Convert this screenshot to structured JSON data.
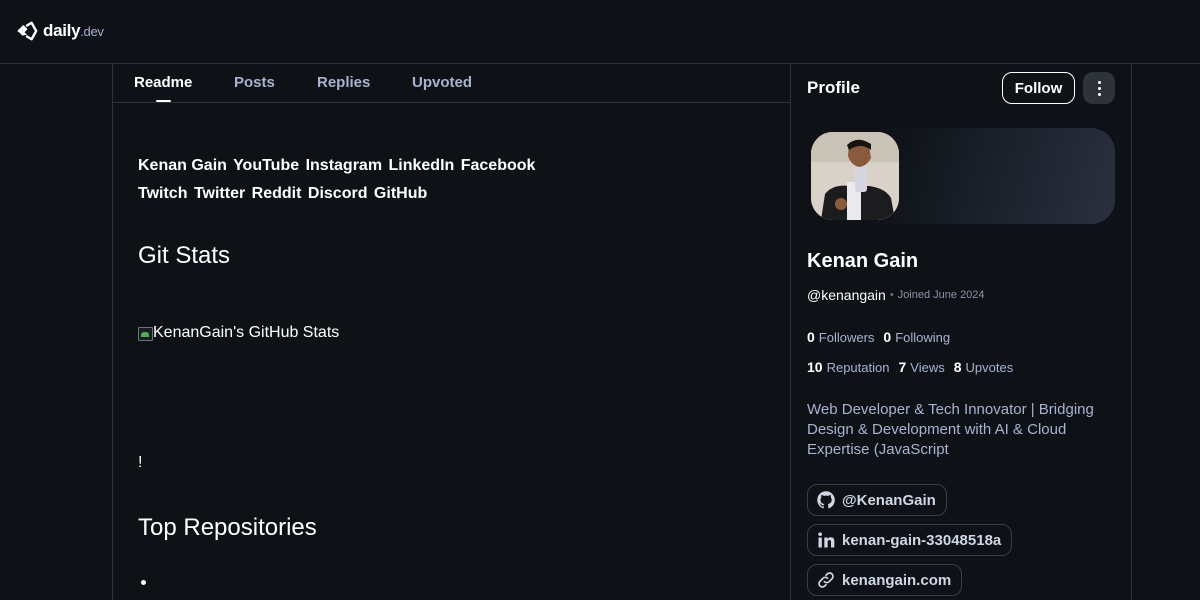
{
  "brand": {
    "name": "daily",
    "suffix": ".dev"
  },
  "tabs": [
    {
      "label": "Readme",
      "active": true
    },
    {
      "label": "Posts",
      "active": false
    },
    {
      "label": "Replies",
      "active": false
    },
    {
      "label": "Upvoted",
      "active": false
    }
  ],
  "readme": {
    "links_row1": [
      "Kenan Gain",
      "YouTube",
      "Instagram",
      "LinkedIn",
      "Facebook"
    ],
    "links_row2": [
      "Twitch",
      "Twitter",
      "Reddit",
      "Discord",
      "GitHub"
    ],
    "git_stats_heading": "Git Stats",
    "stats_image_alt": "KenanGain's GitHub Stats",
    "exclamation": "!",
    "top_repos_heading": "Top Repositories"
  },
  "profile": {
    "section_title": "Profile",
    "follow_label": "Follow",
    "name": "Kenan Gain",
    "handle": "@kenangain",
    "separator": "•",
    "joined": "Joined June 2024",
    "followers": {
      "value": "0",
      "label": "Followers"
    },
    "following": {
      "value": "0",
      "label": "Following"
    },
    "reputation": {
      "value": "10",
      "label": "Reputation"
    },
    "views": {
      "value": "7",
      "label": "Views"
    },
    "upvotes": {
      "value": "8",
      "label": "Upvotes"
    },
    "bio": "Web Developer & Tech Innovator | Bridging Design & Development with AI & Cloud Expertise (JavaScript",
    "links": [
      {
        "icon": "github-icon",
        "label": "@KenanGain"
      },
      {
        "icon": "linkedin-icon",
        "label": "kenan-gain-33048518a"
      },
      {
        "icon": "link-icon",
        "label": "kenangain.com"
      }
    ]
  },
  "colors": {
    "background": "#0e1217",
    "border": "#2d323b",
    "muted_text": "#a8b3cf",
    "accent_green": "#4caf50"
  }
}
